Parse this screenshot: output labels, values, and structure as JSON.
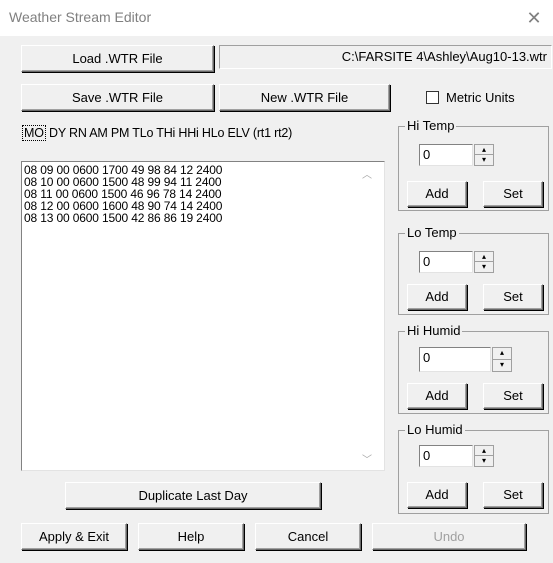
{
  "window": {
    "title": "Weather Stream Editor",
    "close_glyph": "✕"
  },
  "file": {
    "load_label": "Load .WTR File",
    "save_label": "Save .WTR File",
    "new_label": "New .WTR File",
    "path": "C:\\FARSITE 4\\Ashley\\Aug10-13.wtr",
    "metric_label": "Metric Units",
    "metric_checked": false
  },
  "table": {
    "header_mo": "MO",
    "header_rest": "DY RN AM PM  TLo THi  HHi  HLo  ELV  (rt1  rt2)",
    "rows": [
      "08 09 00 0600 1700 49 98 84 12 2400",
      "08 10 00 0600 1500 48 99 94 11 2400",
      "08 11 00 0600 1500 46 96 78 14 2400",
      "08 12 00 0600 1600 48 90 74 14 2400",
      "08 13 00 0600 1500 42 86 86 19 2400"
    ]
  },
  "duplicate_label": "Duplicate Last Day",
  "panels": {
    "hi_temp": {
      "label": "Hi Temp",
      "value": "0",
      "add": "Add",
      "set": "Set"
    },
    "lo_temp": {
      "label": "Lo Temp",
      "value": "0",
      "add": "Add",
      "set": "Set"
    },
    "hi_humid": {
      "label": "Hi Humid",
      "value": "0",
      "add": "Add",
      "set": "Set"
    },
    "lo_humid": {
      "label": "Lo Humid",
      "value": "0",
      "add": "Add",
      "set": "Set"
    }
  },
  "footer": {
    "apply_label": "Apply & Exit",
    "help_label": "Help",
    "cancel_label": "Cancel",
    "undo_label": "Undo"
  }
}
